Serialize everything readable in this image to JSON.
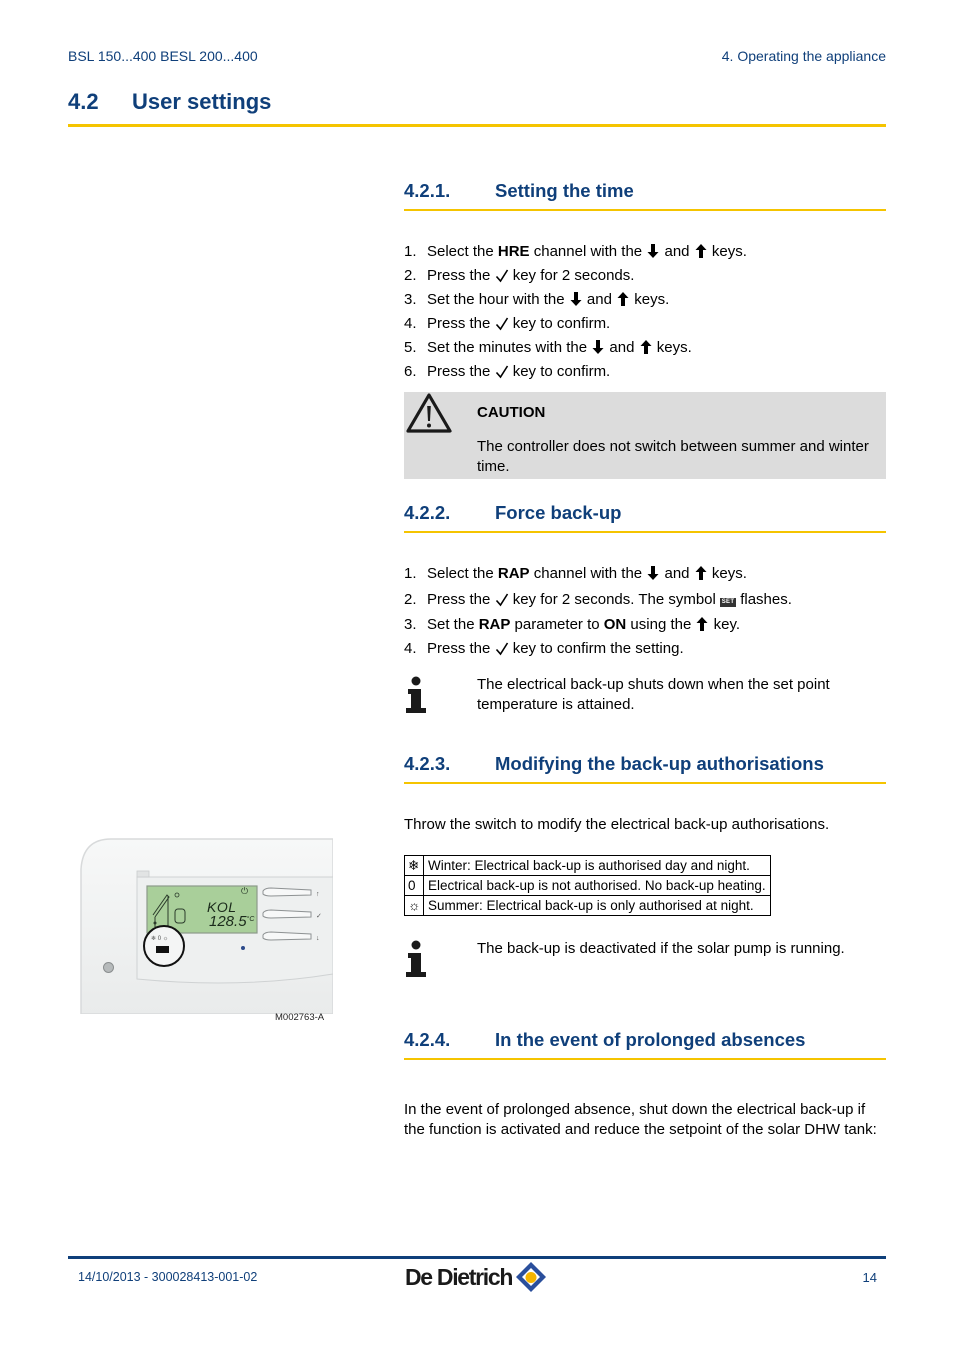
{
  "header": {
    "left": "BSL 150...400 BESL 200...400",
    "right": "4.  Operating the appliance"
  },
  "section": {
    "number": "4.2",
    "title": "User settings"
  },
  "colors": {
    "heading_blue": "#0f3f7a",
    "rule_yellow": "#f5c400",
    "caution_bg": "#dcdcdc"
  },
  "sections": {
    "s1": {
      "number": "4.2.1.",
      "title": "Setting the time",
      "steps": [
        {
          "n": "1.",
          "a": "Select the ",
          "b": "HRE",
          "c": " channel with the ",
          "k1": "down-arrow-key",
          "d": " and ",
          "k2": "up-arrow-key",
          "e": " keys."
        },
        {
          "n": "2.",
          "a": "Press the ",
          "k1": "check-key",
          "e": " key for 2 seconds."
        },
        {
          "n": "3.",
          "a": "Set the hour with the ",
          "k1": "down-arrow-key",
          "d": " and ",
          "k2": "up-arrow-key",
          "e": " keys."
        },
        {
          "n": "4.",
          "a": "Press the ",
          "k1": "check-key",
          "e": " key to confirm."
        },
        {
          "n": "5.",
          "a": "Set the minutes with the ",
          "k1": "down-arrow-key",
          "d": " and ",
          "k2": "up-arrow-key",
          "e": " keys."
        },
        {
          "n": "6.",
          "a": "Press the ",
          "k1": "check-key",
          "e": " key to confirm."
        }
      ],
      "caution": {
        "icon": "warning-triangle-icon",
        "title": "CAUTION",
        "text": "The controller does not switch between summer and winter time."
      }
    },
    "s2": {
      "number": "4.2.2.",
      "title": "Force back-up",
      "steps": [
        {
          "n": "1.",
          "a": "Select the ",
          "b": "RAP",
          "c": " channel with the ",
          "d": " and ",
          "e": " keys."
        },
        {
          "n": "2.",
          "a": "Press the ",
          "c": " key for 2 seconds. The symbol ",
          "sym": "SET",
          "e": " flashes."
        },
        {
          "n": "3.",
          "a": "Set the ",
          "b": "RAP",
          "c": " parameter to ",
          "b2": "ON",
          "d": " using the ",
          "e": " key."
        },
        {
          "n": "4.",
          "a": "Press the ",
          "e": " key to confirm the setting."
        }
      ],
      "info": "The electrical back-up shuts down when the set point temperature is attained."
    },
    "s3": {
      "number": "4.2.3.",
      "title": "Modifying the back-up authorisations",
      "intro": "Throw the switch to modify the electrical back-up authorisations.",
      "table": [
        {
          "symbol": "❄",
          "symbol_name": "winter-snowflake-icon",
          "text": "Winter: Electrical back-up is authorised day and night."
        },
        {
          "symbol": "0",
          "symbol_name": "zero-position",
          "text": "Electrical back-up is not authorised. No back-up heating."
        },
        {
          "symbol": "☼",
          "symbol_name": "summer-sun-icon",
          "text": "Summer: Electrical back-up is only authorised at night."
        }
      ],
      "info": "The back-up is deactivated if the solar pump is running."
    },
    "s4": {
      "number": "4.2.4.",
      "title": "In the event of prolonged absences",
      "text": "In the event of prolonged absence, shut down the electrical back-up if the function is activated and reduce the setpoint of the solar DHW tank:"
    }
  },
  "figure": {
    "display_line1": "KOL",
    "display_line2": "128.5",
    "display_unit": "°C",
    "switch_labels": "❄ 0 ☼",
    "caption": "M002763-A"
  },
  "footer": {
    "left": "14/10/2013 - 300028413-001-02",
    "brand": "De Dietrich",
    "page": "14"
  }
}
